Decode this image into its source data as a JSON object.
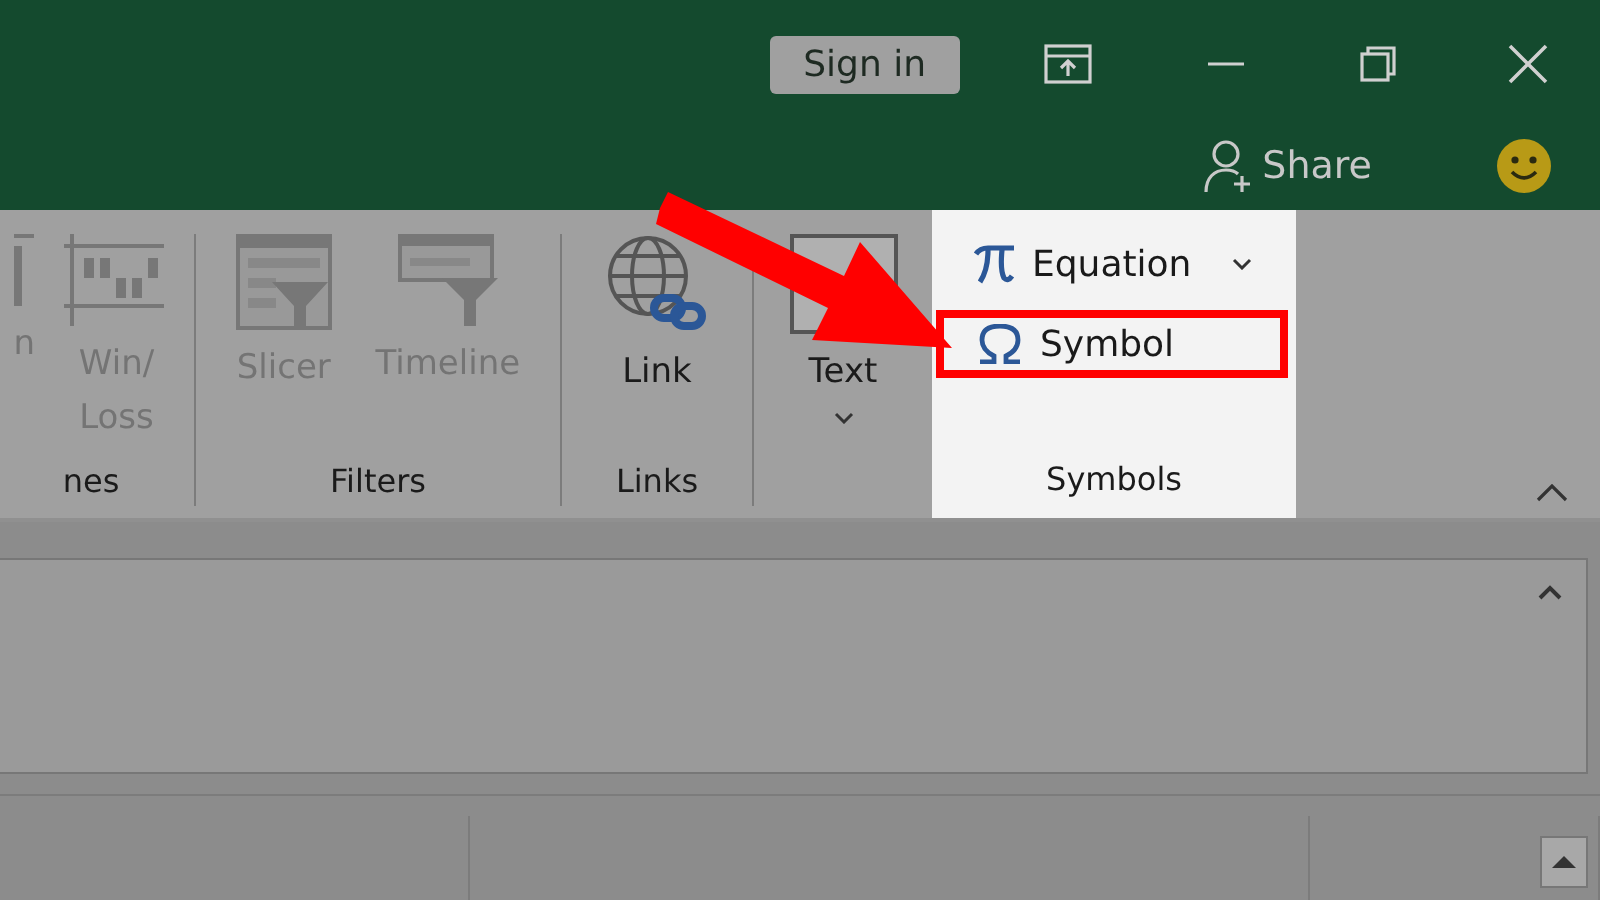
{
  "title_bar": {
    "sign_in": "Sign in"
  },
  "share": {
    "label": "Share"
  },
  "ribbon": {
    "groups": [
      {
        "label": "nes",
        "buttons": [
          {
            "kind": "column",
            "label": "n",
            "disabled": true
          },
          {
            "kind": "winloss",
            "label": "Win/ Loss",
            "disabled": true
          }
        ]
      },
      {
        "label": "Filters",
        "buttons": [
          {
            "kind": "slicer",
            "label": "Slicer",
            "disabled": true
          },
          {
            "kind": "timeline",
            "label": "Timeline",
            "disabled": true
          }
        ]
      },
      {
        "label": "Links",
        "buttons": [
          {
            "kind": "link",
            "label": "Link",
            "disabled": false
          }
        ]
      },
      {
        "buttons": [
          {
            "kind": "text",
            "label": "Text",
            "disabled": false
          }
        ]
      }
    ],
    "symbols": {
      "label": "Symbols",
      "items": [
        {
          "kind": "equation",
          "label": "Equation",
          "selected": false
        },
        {
          "kind": "symbol",
          "label": "Symbol",
          "selected": true
        }
      ]
    }
  }
}
